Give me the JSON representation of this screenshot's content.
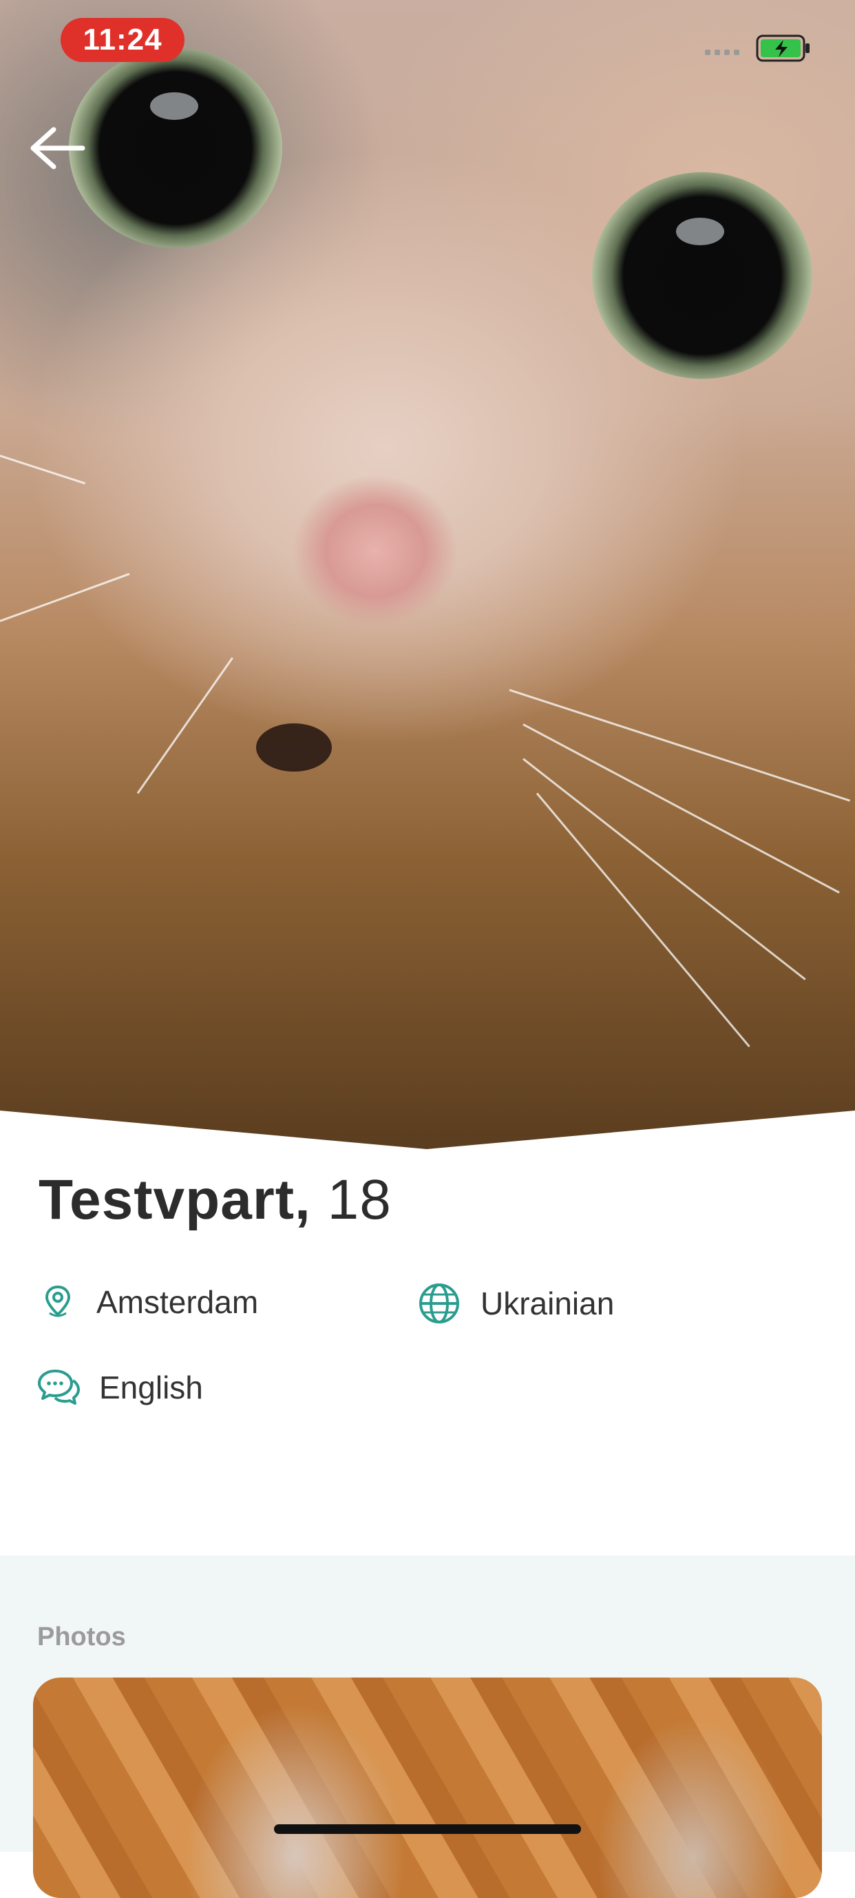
{
  "status_bar": {
    "time": "11:24",
    "battery_color": "#35c24a"
  },
  "header": {
    "back_icon": "arrow-left-icon"
  },
  "profile": {
    "name": "Testvpart,",
    "age": "18",
    "location": "Amsterdam",
    "nationality": "Ukrainian",
    "language": "English",
    "icon_color": "#2a9d8f"
  },
  "photos": {
    "title": "Photos"
  }
}
